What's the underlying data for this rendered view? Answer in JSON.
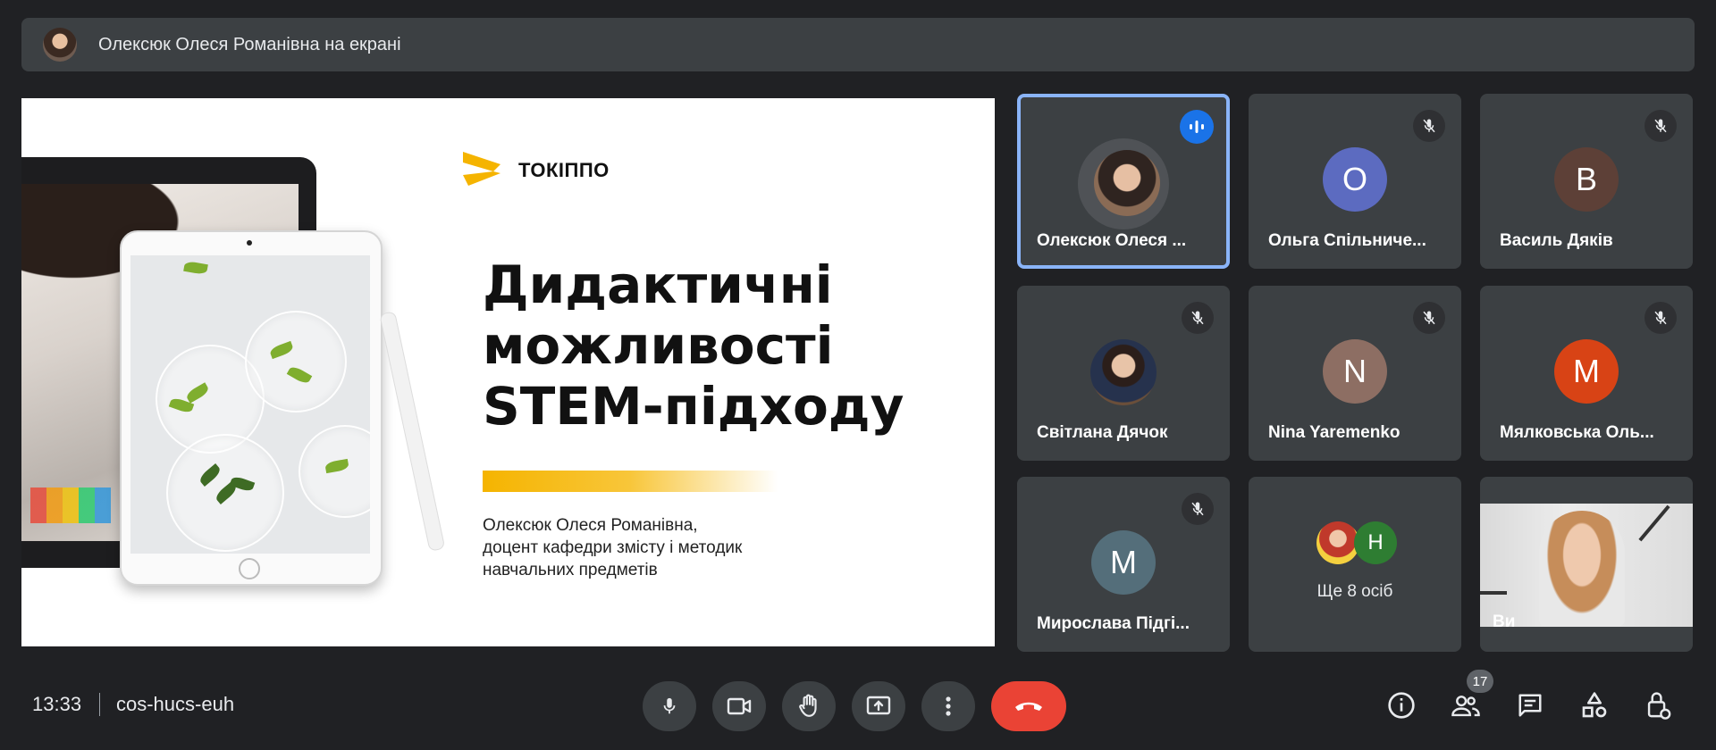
{
  "banner": {
    "presenter_text": "Олексюк Олеся Романівна на екрані"
  },
  "slide": {
    "brand": "ТОКІППО",
    "title_lines": [
      "Дидактичні",
      "можливості",
      "STEM-підходу"
    ],
    "subtitle_lines": [
      "Олексюк Олеся Романівна,",
      "доцент кафедри змісту і методик",
      "навчальних предметів"
    ],
    "brand_color": "#f5b400"
  },
  "participants": [
    {
      "name": "Олексюк Олеся ...",
      "type": "photo",
      "status": "speaking"
    },
    {
      "name": "Ольга Спільниче...",
      "initial": "О",
      "color": "#5c6bc0",
      "status": "muted"
    },
    {
      "name": "Василь Дяків",
      "initial": "В",
      "color": "#5d4037",
      "status": "muted"
    },
    {
      "name": "Світлана Дячок",
      "type": "photo",
      "status": "muted"
    },
    {
      "name": "Nina Yaremenko",
      "initial": "N",
      "color": "#8d6e63",
      "status": "muted"
    },
    {
      "name": "Мялковська Оль...",
      "initial": "М",
      "color": "#d84315",
      "status": "muted"
    },
    {
      "name": "Мирослава Підгі...",
      "initial": "М",
      "color": "#546e7a",
      "status": "muted"
    },
    {
      "name": "Ще 8 осіб",
      "initial": "Н",
      "color": "#2e7d32",
      "type": "group"
    },
    {
      "name": "Ви",
      "type": "video"
    }
  ],
  "controls": {
    "time": "13:33",
    "meeting_code": "cos-hucs-euh",
    "people_count": "17",
    "icons": [
      "mic-icon",
      "camera-icon",
      "raise-hand-icon",
      "present-icon",
      "more-icon",
      "end-call-icon"
    ],
    "right_icons": [
      "info-icon",
      "people-icon",
      "chat-icon",
      "activities-icon",
      "host-controls-icon"
    ]
  }
}
